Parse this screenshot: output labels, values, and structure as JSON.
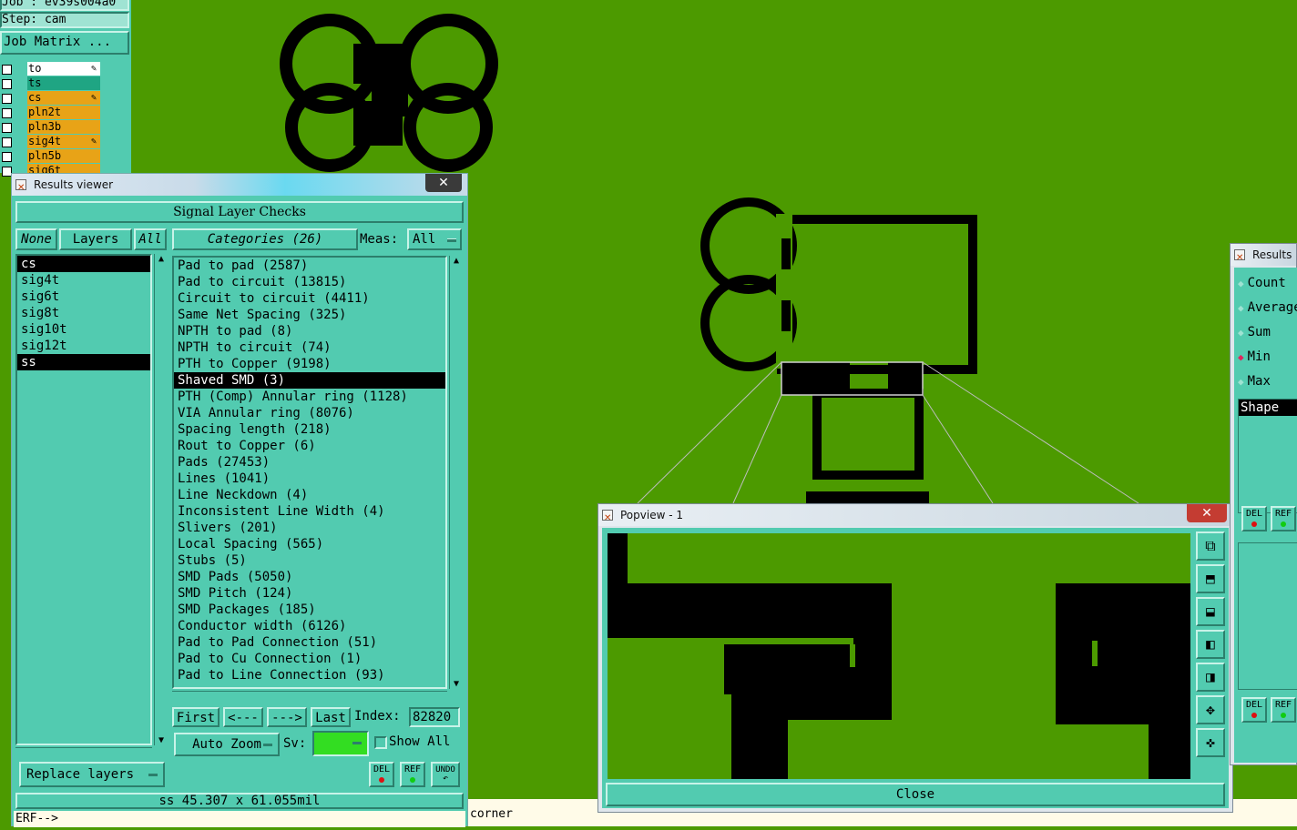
{
  "top_left": {
    "job": "Job : ev39s004a0",
    "step": "Step: cam",
    "job_matrix": "Job Matrix ...",
    "layers": [
      {
        "name": "to",
        "style": "white",
        "has_icon": true
      },
      {
        "name": "ts",
        "style": "teal",
        "has_icon": false
      },
      {
        "name": "cs",
        "style": "orange",
        "has_icon": true
      },
      {
        "name": "pln2t",
        "style": "orange",
        "has_icon": false
      },
      {
        "name": "pln3b",
        "style": "orange",
        "has_icon": false
      },
      {
        "name": "sig4t",
        "style": "orange",
        "has_icon": true
      },
      {
        "name": "pln5b",
        "style": "orange",
        "has_icon": false
      },
      {
        "name": "sig6t",
        "style": "orange",
        "has_icon": false
      }
    ]
  },
  "results_viewer": {
    "title": "Results viewer",
    "close": "✕",
    "header": "Signal Layer Checks",
    "none": "None",
    "layers_label": "Layers",
    "all": "All",
    "categories_label": "Categories (26)",
    "meas_label": "Meas:",
    "meas_value": "All",
    "layer_list": [
      "cs",
      "sig4t",
      "sig6t",
      "sig8t",
      "sig10t",
      "sig12t",
      "ss"
    ],
    "selected_layers": [
      "cs",
      "ss"
    ],
    "categories": [
      "Pad to pad (2587)",
      "Pad to circuit (13815)",
      "Circuit to circuit (4411)",
      "Same Net Spacing (325)",
      "NPTH to pad (8)",
      "NPTH to circuit (74)",
      "PTH to Copper (9198)",
      "Shaved SMD (3)",
      "PTH (Comp) Annular ring (1128)",
      "VIA Annular ring (8076)",
      "Spacing length (218)",
      "Rout to Copper (6)",
      "Pads (27453)",
      "Lines (1041)",
      "Line Neckdown (4)",
      "Inconsistent Line Width (4)",
      "Slivers (201)",
      "Local Spacing (565)",
      "Stubs (5)",
      "SMD Pads (5050)",
      "SMD Pitch (124)",
      "SMD Packages (185)",
      "Conductor width (6126)",
      "Pad to Pad Connection (51)",
      "Pad to Cu Connection (1)",
      "Pad to Line Connection (93)"
    ],
    "selected_category": "Shaved SMD (3)",
    "first": "First",
    "prev": "<---",
    "next": "--->",
    "last": "Last",
    "index_label": "Index:",
    "index_value": "82820",
    "auto_zoom": "Auto Zoom",
    "sv_label": "Sv:",
    "show_all": "Show All",
    "del": "DEL",
    "ref": "REF",
    "undo": "UNDO",
    "replace_layers": "Replace layers",
    "status": "ss 45.307 x 61.055mil",
    "erf": "ERF-->"
  },
  "status_bar_text": "corner",
  "popview": {
    "title": "Popview - 1",
    "close_x": "✕",
    "close_button": "Close"
  },
  "results_right": {
    "title": "Results",
    "options": [
      {
        "label": "Count",
        "selected": false
      },
      {
        "label": "Average",
        "selected": false
      },
      {
        "label": "Sum",
        "selected": false
      },
      {
        "label": "Min",
        "selected": true
      },
      {
        "label": "Max",
        "selected": false
      }
    ],
    "shape_label": "Shape",
    "del": "DEL",
    "ref": "REF"
  },
  "colors": {
    "canvas_green": "#4c9a00",
    "panel_teal": "#52cbb0",
    "layer_orange": "#e8a317",
    "selection": "#000000",
    "sv_green": "#33dd22"
  }
}
